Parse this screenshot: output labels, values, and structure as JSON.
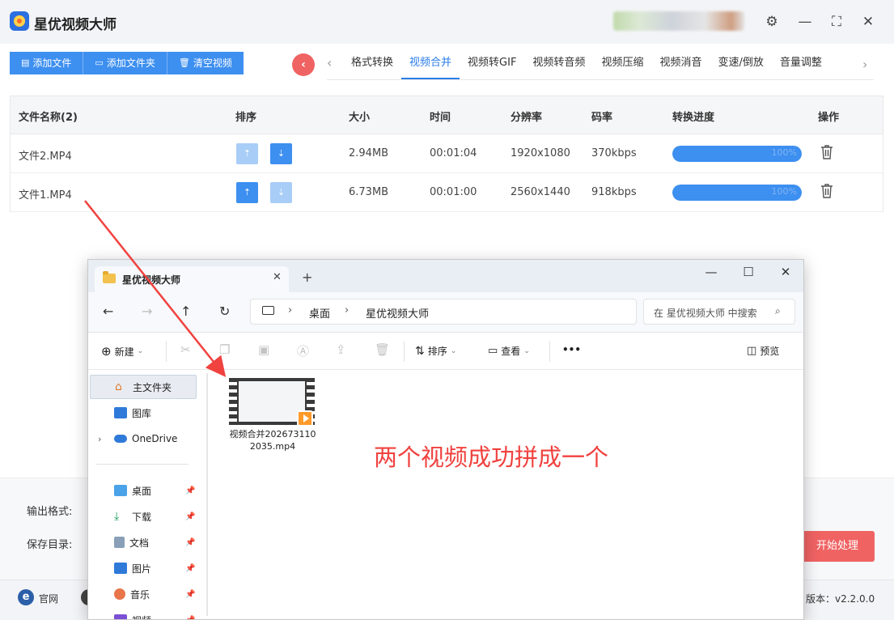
{
  "app": {
    "title": "星优视频大师",
    "window_controls": {
      "settings": "⚙",
      "minimize": "—",
      "maximize": "⛶",
      "close": "✕"
    }
  },
  "toolbar": {
    "add_file": "添加文件",
    "add_folder": "添加文件夹",
    "clear_video": "清空视频",
    "tabs": [
      "格式转换",
      "视频合并",
      "视频转GIF",
      "视频转音频",
      "视频压缩",
      "视频消音",
      "变速/倒放",
      "音量调整"
    ],
    "active_tab": "视频合并"
  },
  "table": {
    "headers": {
      "name": "文件名称(2)",
      "sort": "排序",
      "size": "大小",
      "time": "时间",
      "resolution": "分辨率",
      "bitrate": "码率",
      "progress": "转换进度",
      "action": "操作"
    },
    "rows": [
      {
        "name": "文件2.MP4",
        "size": "2.94MB",
        "time": "00:01:04",
        "resolution": "1920x1080",
        "bitrate": "370kbps",
        "progress": 100,
        "progress_text": "100%"
      },
      {
        "name": "文件1.MP4",
        "size": "6.73MB",
        "time": "00:01:00",
        "resolution": "2560x1440",
        "bitrate": "918kbps",
        "progress": 100,
        "progress_text": "100%"
      }
    ]
  },
  "bottom": {
    "output_format_label": "输出格式:",
    "save_dir_label": "保存目录:",
    "start_button": "开始处理"
  },
  "footer": {
    "website": "官网",
    "version": "版本：v2.2.0.0"
  },
  "explorer": {
    "tab_title": "星优视频大师",
    "breadcrumb": [
      "桌面",
      "星优视频大师"
    ],
    "search_placeholder": "在 星优视频大师 中搜索",
    "commands": {
      "new": "新建",
      "sort": "排序",
      "view": "查看",
      "more": "•••",
      "preview": "预览"
    },
    "sidebar": {
      "home": "主文件夹",
      "gallery": "图库",
      "onedrive": "OneDrive",
      "desktop": "桌面",
      "downloads": "下载",
      "documents": "文档",
      "pictures": "图片",
      "music": "音乐",
      "videos": "视频"
    },
    "file": {
      "name": "视频合并2026731102035.mp4"
    }
  },
  "annotation": {
    "text": "两个视频成功拼成一个",
    "color": "#f0423f"
  },
  "colors": {
    "accent": "#3d8ff0",
    "danger": "#f06363"
  }
}
